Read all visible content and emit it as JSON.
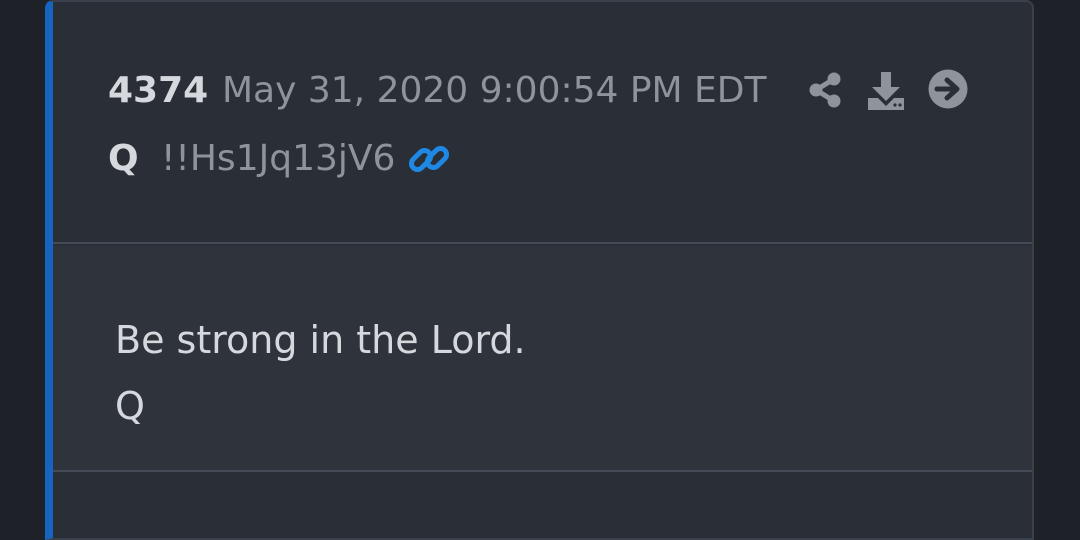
{
  "post": {
    "number": "4374",
    "date": "May 31, 2020 9:00:54 PM EDT",
    "author": "Q",
    "tripcode": "!!Hs1Jq13jV6",
    "message_lines": [
      "Be strong in the Lord.",
      "Q"
    ]
  },
  "icons": {
    "share": "share-icon",
    "download": "download-icon",
    "next": "arrow-right-circle-icon",
    "link": "link-icon"
  },
  "colors": {
    "accent": "#1565c0",
    "link": "#1e88e5",
    "card": "#2a2e36",
    "background": "#1e2127"
  }
}
